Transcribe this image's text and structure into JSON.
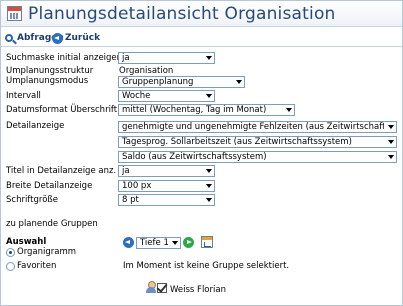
{
  "window": {
    "title": "Planungsdetailansicht Organisation"
  },
  "toolbar": {
    "abfragen_label": "Abfragen",
    "zurueck_label": "Zurück"
  },
  "form": {
    "suchmaske": {
      "label": "Suchmaske initial anzeigen",
      "value": "ja"
    },
    "umplanungsstruktur": {
      "label": "Umplanungsstruktur",
      "value": "Organisation"
    },
    "umplanungsmodus": {
      "label": "Umplanungsmodus",
      "value": "Gruppenplanung"
    },
    "intervall": {
      "label": "Intervall",
      "value": "Woche"
    },
    "datumsformat": {
      "label": "Datumsformat Überschrift",
      "value": "mittel (Wochentag, Tag im Monat)"
    },
    "detailanzeige": {
      "label": "Detailanzeige",
      "values": [
        "genehmigte und ungenehmigte Fehlzeiten (aus Zeitwirtschaftssystem)",
        "Tagesprog. Sollarbeitszeit (aus Zeitwirtschaftssystem)",
        "Saldo (aus Zeitwirtschaftssystem)"
      ]
    },
    "titel_detailanzeige": {
      "label": "Titel in Detailanzeige anz.",
      "value": "ja"
    },
    "breite_detailanzeige": {
      "label": "Breite Detailanzeige",
      "value": "100 px"
    },
    "schriftgroesse": {
      "label": "Schriftgröße",
      "value": "8 pt"
    }
  },
  "gruppen": {
    "heading": "zu planende Gruppen",
    "auswahl_label": "Auswahl",
    "options": [
      {
        "label": "Organigramm",
        "checked": true
      },
      {
        "label": "Favoriten",
        "checked": false
      }
    ],
    "tiefe_value": "Tiefe 1",
    "status_text": "Im Moment ist keine Gruppe selektiert.",
    "person_name": "Weiss Florian"
  },
  "icons": {
    "title": "calendar-icon",
    "abfragen": "search-icon",
    "zurueck": "back-arrow-icon",
    "nav_back": "back-arrow-icon",
    "go": "go-arrow-icon",
    "tree": "org-tree-icon",
    "person": "person-icon",
    "check": "checkbox-icon"
  },
  "colors": {
    "title": "#2b4a73",
    "toolbar": "#1f3d66",
    "select_border": "#7f9db9",
    "accent_blue": "#2f6fba",
    "accent_green": "#2fa84a"
  }
}
